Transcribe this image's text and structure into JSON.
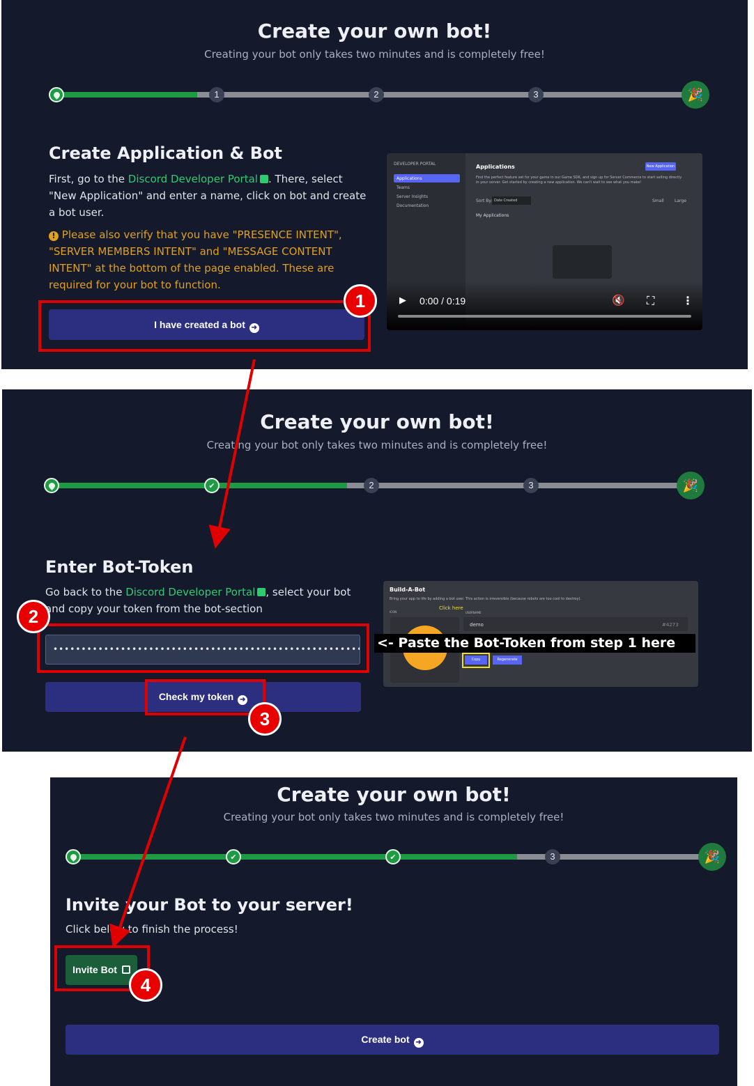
{
  "common": {
    "title": "Create your own bot!",
    "subtitle": "Creating your bot only takes two minutes and is completely free!",
    "step_numbers": [
      "1",
      "2",
      "3"
    ],
    "link_text": "Discord Developer Portal"
  },
  "step1": {
    "heading": "Create Application & Bot",
    "intro_before_link": "First, go to the ",
    "intro_after_link": ". There, select \"New Application\" and enter a name, click on bot and create a bot user.",
    "warning": "Please also verify that you have \"PRESENCE INTENT\", \"SERVER MEMBERS INTENT\" and \"MESSAGE CONTENT INTENT\" at the bottom of the page enabled. These are required for your bot to function.",
    "button_label": "I have created a bot",
    "progress_fraction": 0.22,
    "video": {
      "time": "0:00 / 0:19",
      "sidebar_header": "DEVELOPER PORTAL",
      "sidebar_items": [
        "Applications",
        "Teams",
        "Server Insights",
        "Documentation"
      ],
      "main_title": "Applications",
      "new_app_button": "New Application",
      "description": "Find the perfect feature set for your game in our Game SDK, and sign up for Server Commerce to start selling directly in your server. Get started by creating a new application. We can't wait to see what you make!",
      "sort_label": "Sort By:",
      "sort_value": "Date Created",
      "view_small": "Small",
      "view_large": "Large",
      "my_apps": "My Applications"
    }
  },
  "step2": {
    "heading": "Enter Bot-Token",
    "intro_before_link": "Go back to the ",
    "intro_after_link": ", select your bot and copy your token from the bot-section",
    "token_value": "••••••••••••••••••••••••••••••••••••••••••••••••••••••••••••••••••••••",
    "button_label": "Check my token",
    "paste_hint": "<- Paste the Bot-Token from step 1 here",
    "progress_fraction": 0.44,
    "bab": {
      "title": "Build-A-Bot",
      "description": "Bring your app to life by adding a bot user. This action is irreversible (because robots are too cool to destroy).",
      "icon_label": "ICON",
      "username_label": "USERNAME",
      "username": "demo",
      "discriminator": "#4273",
      "click_here": "Click here",
      "copy": "Copy",
      "regenerate": "Regenerate"
    }
  },
  "step3": {
    "heading": "Invite your Bot to your server!",
    "text": "Click below to finish the process!",
    "invite_label": "Invite Bot",
    "button_label": "Create bot",
    "progress_fraction": 0.72
  },
  "annotations": [
    "1",
    "2",
    "3",
    "4"
  ],
  "colors": {
    "panel_bg": "#141a2b",
    "progress_green": "#1f9a44",
    "link_green": "#2ecc71",
    "warning_orange": "#e0a020",
    "button_indigo": "#2c2f7f",
    "annotation_red": "#e00000"
  }
}
